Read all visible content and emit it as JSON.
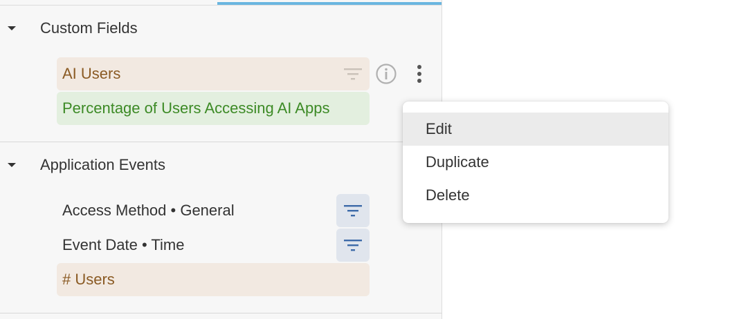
{
  "sections": [
    {
      "title": "Custom Fields",
      "fields": [
        {
          "label": "AI Users",
          "kind": "measure"
        },
        {
          "label": "Percentage of Users Accessing AI Apps",
          "kind": "calculation"
        }
      ]
    },
    {
      "title": "Application Events",
      "fields": [
        {
          "label": "Access Method • General",
          "kind": "dimension"
        },
        {
          "label": "Event Date • Time",
          "kind": "dimension"
        },
        {
          "label": "# Users",
          "kind": "measure"
        }
      ]
    }
  ],
  "context_menu": {
    "items": [
      "Edit",
      "Duplicate",
      "Delete"
    ],
    "highlighted": "Edit"
  },
  "colors": {
    "measure_bg": "#f2e9e1",
    "measure_text": "#8a5a23",
    "calculation_bg": "#e3efdf",
    "calculation_text": "#3c8a25",
    "filter_active": "#3d6aa8",
    "accent": "#6ab6e0"
  },
  "icons": {
    "filter": "filter-icon",
    "info": "info-icon",
    "more": "more-vertical-icon",
    "collapse": "caret-down-icon"
  }
}
